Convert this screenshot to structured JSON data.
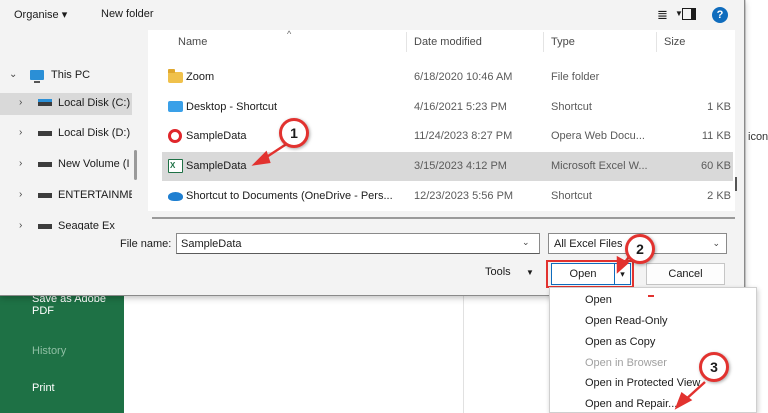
{
  "background": {
    "sidebar_items": [
      "Save as Adobe PDF",
      "History",
      "Print"
    ],
    "right_text": "icon",
    "colors": {
      "excel_green": "#1e7145"
    }
  },
  "toolbar": {
    "organise": "Organise ▾",
    "new_folder": "New folder",
    "view_icon": "≣",
    "pane_icon": "preview-pane-icon",
    "help_icon": "?"
  },
  "nav": {
    "items": [
      {
        "label": "This PC",
        "icon": "pc-icon",
        "expanded": true
      },
      {
        "label": "Local Disk (C:)",
        "icon": "drive-c-icon",
        "selected": true
      },
      {
        "label": "Local Disk (D:)",
        "icon": "drive-icon"
      },
      {
        "label": "New Volume (I",
        "icon": "drive-icon"
      },
      {
        "label": "ENTERTAINME",
        "icon": "drive-icon"
      },
      {
        "label": "Seagate Ex",
        "icon": "drive-icon"
      }
    ]
  },
  "file_list": {
    "columns": [
      "Name",
      "Date modified",
      "Type",
      "Size"
    ],
    "rows": [
      {
        "name": "Zoom",
        "date": "6/18/2020 10:46 AM",
        "type": "File folder",
        "size": "",
        "icon": "folder-icon"
      },
      {
        "name": "Desktop - Shortcut",
        "date": "4/16/2021 5:23 PM",
        "type": "Shortcut",
        "size": "1 KB",
        "icon": "desktop-shortcut-icon"
      },
      {
        "name": "SampleData",
        "date": "11/24/2023 8:27 PM",
        "type": "Opera Web Docu...",
        "size": "11 KB",
        "icon": "opera-icon"
      },
      {
        "name": "SampleData",
        "date": "3/15/2023 4:12 PM",
        "type": "Microsoft Excel W...",
        "size": "60 KB",
        "icon": "excel-icon",
        "selected": true
      },
      {
        "name": "Shortcut to Documents (OneDrive - Pers...",
        "date": "12/23/2023 5:56 PM",
        "type": "Shortcut",
        "size": "2 KB",
        "icon": "onedrive-icon"
      }
    ]
  },
  "bottom": {
    "file_name_label": "File name:",
    "file_name_value": "SampleData",
    "filter_value": "All Excel Files",
    "tools_label": "Tools",
    "open_label": "Open",
    "open_split_icon": "▾",
    "cancel_label": "Cancel"
  },
  "open_menu": {
    "items": [
      {
        "label": "Open",
        "enabled": true
      },
      {
        "label": "Open Read-Only",
        "enabled": true
      },
      {
        "label": "Open as Copy",
        "enabled": true
      },
      {
        "label": "Open in Browser",
        "enabled": false
      },
      {
        "label": "Open in Protected View",
        "enabled": true
      },
      {
        "label": "Open and Repair...",
        "enabled": true
      }
    ]
  },
  "annotations": {
    "callouts": [
      "1",
      "2",
      "3"
    ],
    "color": "#e2322f"
  }
}
